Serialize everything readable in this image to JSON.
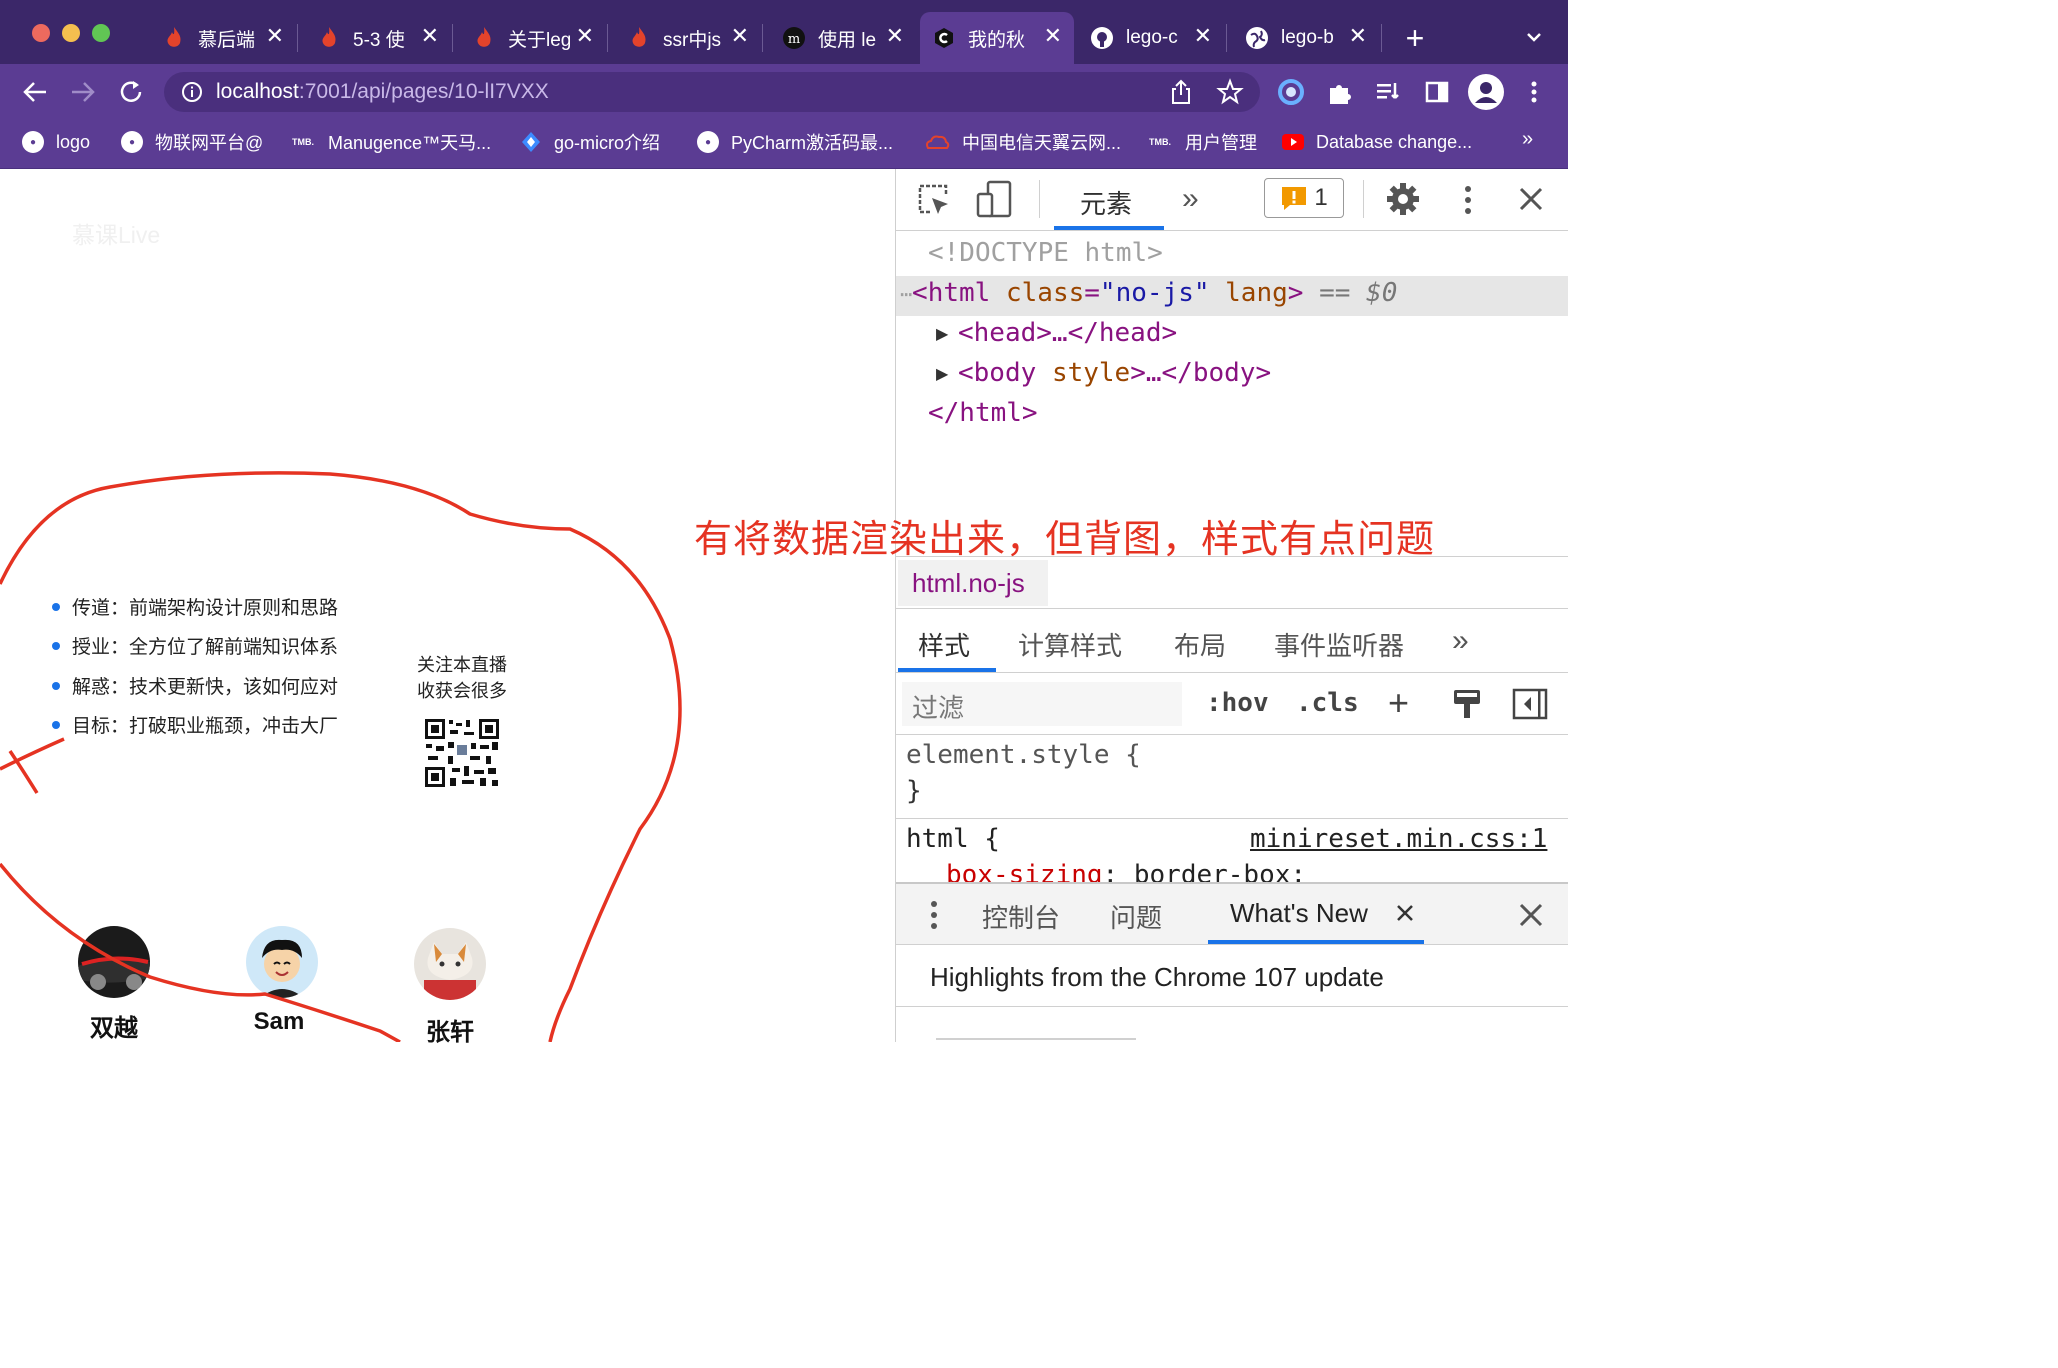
{
  "browser": {
    "tabs": [
      {
        "title": "慕后端",
        "icon": "flame-icon",
        "active": false
      },
      {
        "title": "5-3 使",
        "icon": "flame-icon",
        "active": false
      },
      {
        "title": "关于leg",
        "icon": "flame-icon",
        "active": false
      },
      {
        "title": "ssr中js",
        "icon": "flame-icon",
        "active": false
      },
      {
        "title": "使用 le",
        "icon": "m-logo-icon",
        "active": false
      },
      {
        "title": "我的秋",
        "icon": "c-logo-icon",
        "active": true
      },
      {
        "title": "lego-c",
        "icon": "github-icon",
        "active": false
      },
      {
        "title": "lego-b",
        "icon": "globe-icon",
        "active": false
      }
    ],
    "new_tab_label": "+",
    "tab_close": "✕",
    "url_host": "localhost",
    "url_rest": ":7001/api/pages/10-lI7VXX",
    "bookmarks": [
      {
        "label": "logo",
        "icon": "globe-icon"
      },
      {
        "label": "物联网平台@",
        "icon": "globe-icon"
      },
      {
        "label": "Manugence™天马...",
        "icon": "tmb-icon"
      },
      {
        "label": "go-micro介绍",
        "icon": "diamond-icon"
      },
      {
        "label": "PyCharm激活码最...",
        "icon": "globe-icon"
      },
      {
        "label": "中国电信天翼云网...",
        "icon": "cloud-icon"
      },
      {
        "label": "用户管理",
        "icon": "tmb-icon"
      },
      {
        "label": "Database change...",
        "icon": "youtube-icon"
      }
    ],
    "bookmarks_overflow": "»"
  },
  "page": {
    "watermark": "慕课Live",
    "bullets": [
      "传道：前端架构设计原则和思路",
      "授业：全方位了解前端知识体系",
      "解惑：技术更新快，该如何应对",
      "目标：打破职业瓶颈，冲击大厂"
    ],
    "qr_caption_1": "关注本直播",
    "qr_caption_2": "收获会很多",
    "people": [
      {
        "name": "双越"
      },
      {
        "name": "Sam"
      },
      {
        "name": "张轩"
      }
    ]
  },
  "annotation_text": "有将数据渲染出来，但背图，样式有点问题",
  "devtools": {
    "top_tab_elements": "元素",
    "more_tabs": "»",
    "issues_count": "1",
    "dom": {
      "doctype": "<!DOCTYPE html>",
      "html_open_tag": "<html",
      "html_attr_name": "class",
      "html_attr_value": "\"no-js\"",
      "html_attr2": "lang",
      "html_close_bracket": ">",
      "selected_marker": "== $0",
      "head": "<head>…</head>",
      "body_open": "<body",
      "body_attr": "style",
      "body_rest": ">…</body>",
      "html_close": "</html>"
    },
    "breadcrumb": "html.no-js",
    "panel_tabs": [
      "样式",
      "计算样式",
      "布局",
      "事件监听器"
    ],
    "panel_more": "»",
    "filter_placeholder": "过滤",
    "hov": ":hov",
    "cls": ".cls",
    "plus": "+",
    "element_style_open": "element.style {",
    "element_style_close": "}",
    "rule_selector": "html {",
    "rule_source": "minireset.min.css:1",
    "rule_prop": "box-sizing",
    "rule_value": "border-box;",
    "drawer_tabs": [
      "控制台",
      "问题",
      "What's New"
    ],
    "drawer_content": "Highlights from the Chrome 107 update",
    "colors": {
      "accent": "#1a73e8",
      "tag": "#881280",
      "attr_name": "#994500",
      "attr_value": "#1a1aa6"
    }
  }
}
